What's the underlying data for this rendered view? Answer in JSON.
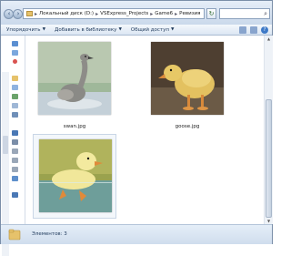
{
  "address": {
    "crumbs": [
      "Локальный диск (D:)",
      "VSExpress_Projects",
      "Game6",
      "Ревизия"
    ]
  },
  "toolbar": {
    "organize": "Упорядочить",
    "add_to_library": "Добавить в библиотеку",
    "share": "Общий доступ"
  },
  "files": [
    {
      "name": "swan.jpg"
    },
    {
      "name": "goose.jpg"
    },
    {
      "name": ""
    }
  ],
  "status": {
    "items": "Элементов: 3"
  },
  "colors": {
    "window_frame": "#c9d9ea",
    "toolbar_text": "#1e395b",
    "selection": "#f3f7fb"
  },
  "icons": {
    "back": "left-arrow-icon",
    "forward": "right-arrow-icon",
    "folder": "folder-icon",
    "search": "search-icon",
    "refresh": "refresh-icon",
    "help": "help-icon",
    "views": "view-options-icon"
  }
}
